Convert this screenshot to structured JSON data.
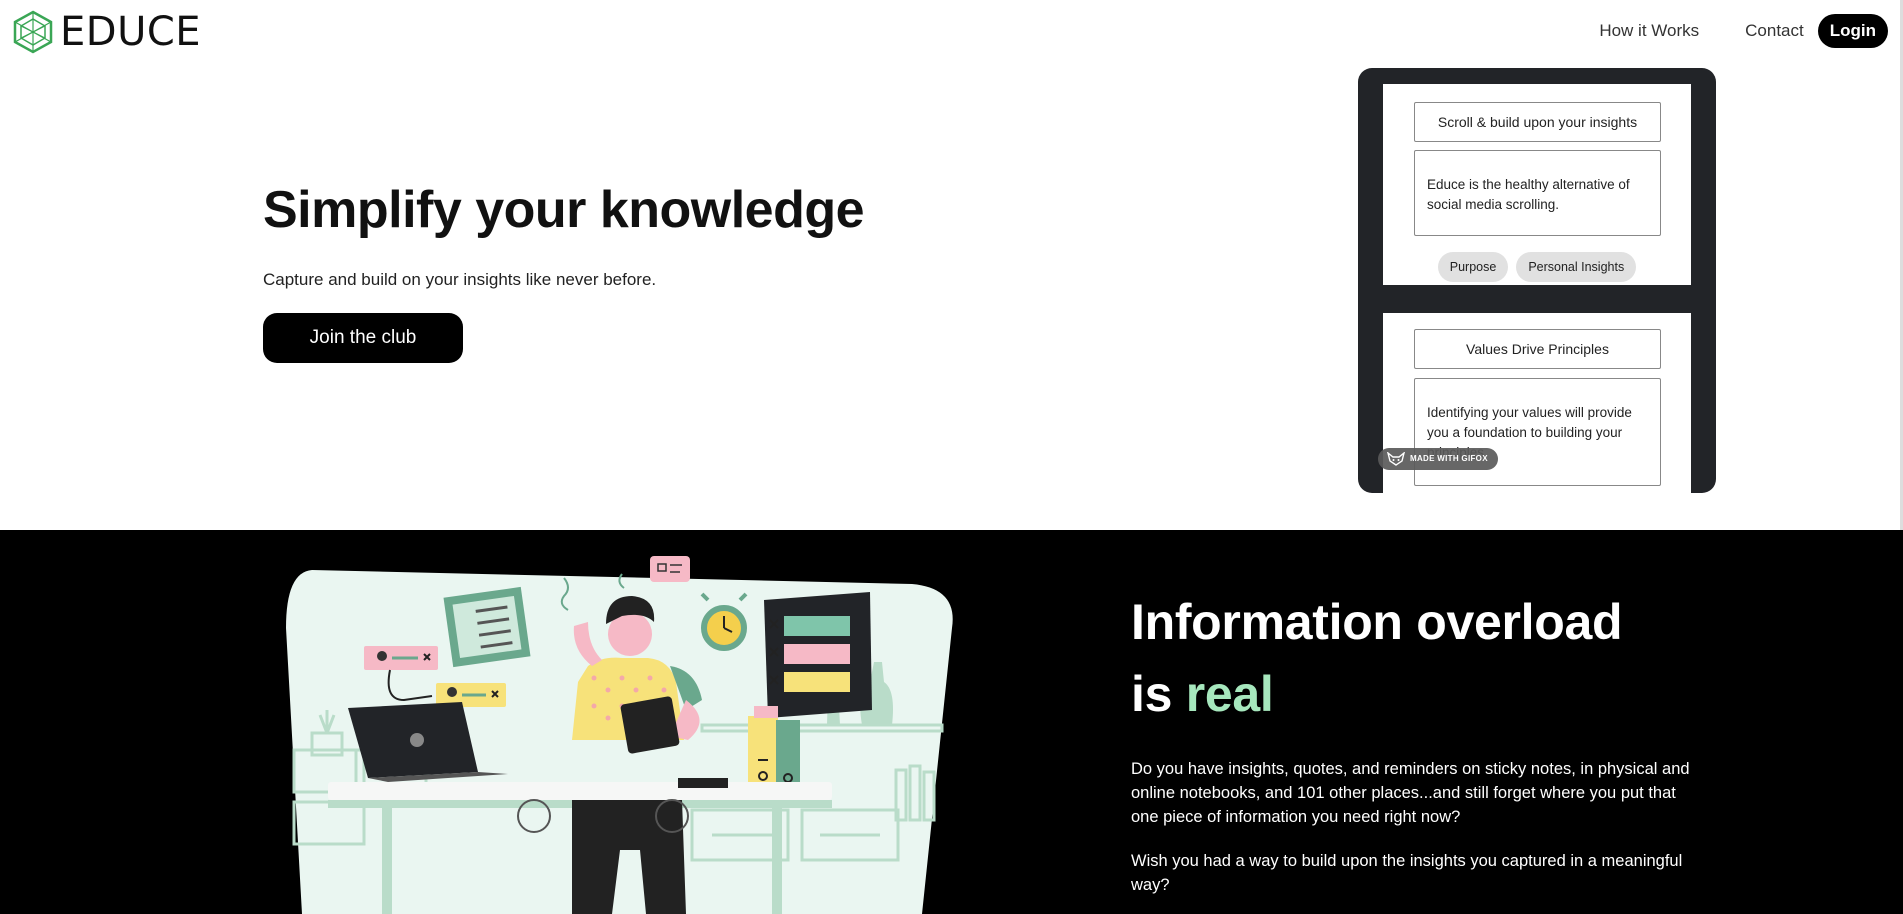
{
  "nav": {
    "logo_text": "EDUCE",
    "links": [
      "How it Works",
      "Contact"
    ],
    "login_label": "Login"
  },
  "hero": {
    "title": "Simplify your knowledge",
    "subtitle": "Capture and build on your insights like never before.",
    "cta_label": "Join the club"
  },
  "phone": {
    "cards": [
      {
        "title": "Scroll & build upon your insights",
        "body": "Educe is the healthy alternative of social media scrolling.",
        "tags": [
          "Purpose",
          "Personal Insights"
        ]
      },
      {
        "title": "Values Drive Principles",
        "body": "Identifying your values will provide you a foundation to building your principles."
      }
    ],
    "badge": "MADE WITH GIFOX"
  },
  "overload": {
    "title_line1": "Information overload",
    "title_is": "is ",
    "title_accent": "real",
    "paragraph1": "Do you have insights, quotes, and reminders on sticky notes, in physical and online notebooks, and 101 other places...and still forget where you put that one piece of information you need right now?",
    "paragraph2": "Wish you had a way to build upon the insights you captured in a meaningful way?"
  },
  "colors": {
    "brand_green": "#3aa655",
    "accent_mint": "#a6e7bd",
    "dark_bg": "#000000",
    "phone_frame": "#222428"
  },
  "icons": [
    "educe-logo-icon",
    "gifox-fox-icon"
  ]
}
